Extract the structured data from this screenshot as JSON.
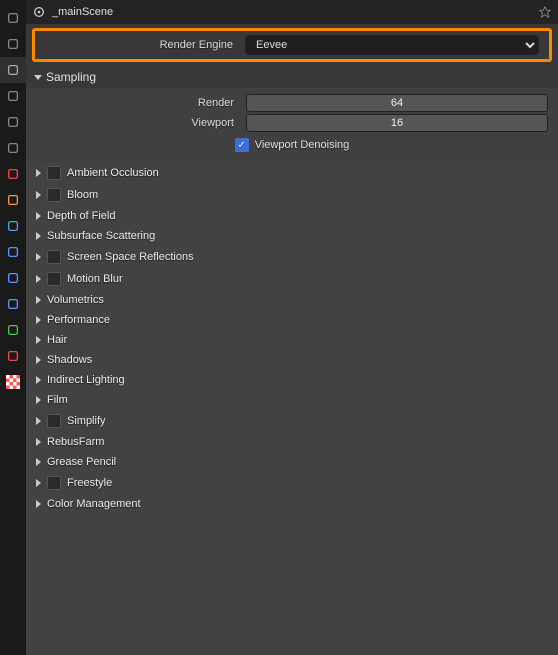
{
  "header": {
    "scene_name": "_mainScene"
  },
  "engine": {
    "label": "Render Engine",
    "value": "Eevee"
  },
  "sampling": {
    "title": "Sampling",
    "render_label": "Render",
    "render_value": "64",
    "viewport_label": "Viewport",
    "viewport_value": "16",
    "denoise_label": "Viewport Denoising",
    "denoise_checked": true
  },
  "panels": [
    {
      "label": "Ambient Occlusion",
      "checkbox": true
    },
    {
      "label": "Bloom",
      "checkbox": true
    },
    {
      "label": "Depth of Field",
      "checkbox": false
    },
    {
      "label": "Subsurface Scattering",
      "checkbox": false
    },
    {
      "label": "Screen Space Reflections",
      "checkbox": true
    },
    {
      "label": "Motion Blur",
      "checkbox": true
    },
    {
      "label": "Volumetrics",
      "checkbox": false
    },
    {
      "label": "Performance",
      "checkbox": false
    },
    {
      "label": "Hair",
      "checkbox": false
    },
    {
      "label": "Shadows",
      "checkbox": false
    },
    {
      "label": "Indirect Lighting",
      "checkbox": false
    },
    {
      "label": "Film",
      "checkbox": false
    },
    {
      "label": "Simplify",
      "checkbox": true
    },
    {
      "label": "RebusFarm",
      "checkbox": false
    },
    {
      "label": "Grease Pencil",
      "checkbox": false
    },
    {
      "label": "Freestyle",
      "checkbox": true
    },
    {
      "label": "Color Management",
      "checkbox": false
    }
  ],
  "tabs": [
    {
      "name": "editor-type-icon",
      "cls": ""
    },
    {
      "name": "tool-icon",
      "cls": ""
    },
    {
      "name": "render-icon",
      "cls": "active"
    },
    {
      "name": "output-icon",
      "cls": ""
    },
    {
      "name": "viewlayer-icon",
      "cls": ""
    },
    {
      "name": "scene-icon",
      "cls": ""
    },
    {
      "name": "world-icon",
      "cls": "red"
    },
    {
      "name": "object-icon",
      "cls": "orange"
    },
    {
      "name": "modifier-icon",
      "cls": "blue"
    },
    {
      "name": "particle-icon",
      "cls": "blue"
    },
    {
      "name": "physics-icon",
      "cls": "blue"
    },
    {
      "name": "constraint-icon",
      "cls": "blue"
    },
    {
      "name": "mesh-icon",
      "cls": "green"
    },
    {
      "name": "material-icon",
      "cls": "red"
    },
    {
      "name": "texture-icon",
      "cls": "checker"
    }
  ]
}
